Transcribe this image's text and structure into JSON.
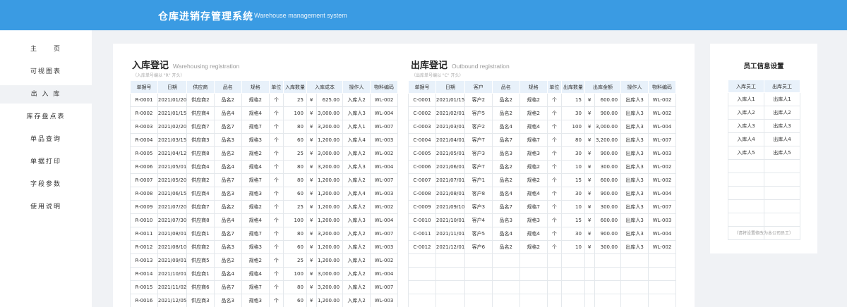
{
  "header": {
    "title": "仓库进销存管理系统",
    "subtitle": "Warehouse management system"
  },
  "sidebar": {
    "items": [
      {
        "label": "主　　页"
      },
      {
        "label": "可视图表"
      },
      {
        "label": "出 入 库"
      },
      {
        "label": "库存盘点表"
      },
      {
        "label": "单品查询"
      },
      {
        "label": "单据打印"
      },
      {
        "label": "字段参数"
      },
      {
        "label": "使用说明"
      }
    ]
  },
  "inbound": {
    "title": "入库登记",
    "title_en": "Warehousing registration",
    "note": "（入库单号编以 \"R\" 开头）",
    "columns": [
      "单据号",
      "日期",
      "供应商",
      "品名",
      "规格",
      "单位",
      "入库数量",
      "入库成本",
      "操作人",
      "物料编码"
    ],
    "rows": [
      [
        "R-0001",
        "2021/01/20",
        "供应商2",
        "品名2",
        "规格2",
        "个",
        "25",
        "¥",
        "625.00",
        "入库人2",
        "WL-002"
      ],
      [
        "R-0002",
        "2021/01/15",
        "供应商4",
        "品名4",
        "规格4",
        "个",
        "100",
        "¥",
        "3,000.00",
        "入库人3",
        "WL-004"
      ],
      [
        "R-0003",
        "2021/02/20",
        "供应商7",
        "品名7",
        "规格7",
        "个",
        "80",
        "¥",
        "3,200.00",
        "入库人1",
        "WL-007"
      ],
      [
        "R-0004",
        "2021/03/15",
        "供应商3",
        "品名3",
        "规格3",
        "个",
        "60",
        "¥",
        "1,200.00",
        "入库人4",
        "WL-003"
      ],
      [
        "R-0005",
        "2021/04/12",
        "供应商8",
        "品名2",
        "规格2",
        "个",
        "25",
        "¥",
        "3,000.00",
        "入库人2",
        "WL-002"
      ],
      [
        "R-0006",
        "2021/05/01",
        "供应商4",
        "品名4",
        "规格4",
        "个",
        "80",
        "¥",
        "3,200.00",
        "入库人3",
        "WL-004"
      ],
      [
        "R-0007",
        "2021/05/20",
        "供应商2",
        "品名7",
        "规格7",
        "个",
        "80",
        "¥",
        "1,200.00",
        "入库人2",
        "WL-007"
      ],
      [
        "R-0008",
        "2021/06/15",
        "供应商4",
        "品名3",
        "规格3",
        "个",
        "60",
        "¥",
        "1,200.00",
        "入库人4",
        "WL-003"
      ],
      [
        "R-0009",
        "2021/07/20",
        "供应商7",
        "品名2",
        "规格2",
        "个",
        "25",
        "¥",
        "1,200.00",
        "入库人2",
        "WL-002"
      ],
      [
        "R-0010",
        "2021/07/30",
        "供应商8",
        "品名4",
        "规格4",
        "个",
        "100",
        "¥",
        "1,200.00",
        "入库人3",
        "WL-004"
      ],
      [
        "R-0011",
        "2021/08/01",
        "供应商1",
        "品名7",
        "规格7",
        "个",
        "80",
        "¥",
        "3,200.00",
        "入库人2",
        "WL-007"
      ],
      [
        "R-0012",
        "2021/08/10",
        "供应商2",
        "品名3",
        "规格3",
        "个",
        "60",
        "¥",
        "1,200.00",
        "入库人2",
        "WL-003"
      ],
      [
        "R-0013",
        "2021/09/01",
        "供应商5",
        "品名2",
        "规格2",
        "个",
        "25",
        "¥",
        "1,200.00",
        "入库人2",
        "WL-002"
      ],
      [
        "R-0014",
        "2021/10/01",
        "供应商1",
        "品名4",
        "规格4",
        "个",
        "100",
        "¥",
        "3,000.00",
        "入库人2",
        "WL-004"
      ],
      [
        "R-0015",
        "2021/11/02",
        "供应商6",
        "品名7",
        "规格7",
        "个",
        "80",
        "¥",
        "3,200.00",
        "入库人2",
        "WL-007"
      ],
      [
        "R-0016",
        "2021/12/05",
        "供应商3",
        "品名3",
        "规格3",
        "个",
        "60",
        "¥",
        "1,200.00",
        "入库人2",
        "WL-003"
      ]
    ]
  },
  "outbound": {
    "title": "出库登记",
    "title_en": "Outbound registration",
    "note": "（出库单号编以 \"C\" 开头）",
    "columns": [
      "单据号",
      "日期",
      "客户",
      "品名",
      "规格",
      "单位",
      "出库数量",
      "出库金额",
      "操作人",
      "物料编码"
    ],
    "rows": [
      [
        "C-0001",
        "2021/01/15",
        "客户2",
        "品名2",
        "规格2",
        "个",
        "15",
        "¥",
        "600.00",
        "出库人3",
        "WL-002"
      ],
      [
        "C-0002",
        "2021/02/01",
        "客户5",
        "品名2",
        "规格2",
        "个",
        "30",
        "¥",
        "900.00",
        "出库人3",
        "WL-002"
      ],
      [
        "C-0003",
        "2021/03/01",
        "客户2",
        "品名4",
        "规格4",
        "个",
        "100",
        "¥",
        "3,000.00",
        "出库人3",
        "WL-004"
      ],
      [
        "C-0004",
        "2021/04/01",
        "客户7",
        "品名7",
        "规格7",
        "个",
        "80",
        "¥",
        "3,200.00",
        "出库人3",
        "WL-007"
      ],
      [
        "C-0005",
        "2021/05/01",
        "客户3",
        "品名3",
        "规格3",
        "个",
        "30",
        "¥",
        "900.00",
        "出库人3",
        "WL-003"
      ],
      [
        "C-0006",
        "2021/06/01",
        "客户7",
        "品名2",
        "规格2",
        "个",
        "10",
        "¥",
        "300.00",
        "出库人3",
        "WL-002"
      ],
      [
        "C-0007",
        "2021/07/01",
        "客户1",
        "品名2",
        "规格2",
        "个",
        "15",
        "¥",
        "600.00",
        "出库人3",
        "WL-002"
      ],
      [
        "C-0008",
        "2021/08/01",
        "客户8",
        "品名4",
        "规格4",
        "个",
        "30",
        "¥",
        "900.00",
        "出库人3",
        "WL-004"
      ],
      [
        "C-0009",
        "2021/09/10",
        "客户3",
        "品名7",
        "规格7",
        "个",
        "10",
        "¥",
        "300.00",
        "出库人3",
        "WL-007"
      ],
      [
        "C-0010",
        "2021/10/01",
        "客户4",
        "品名3",
        "规格3",
        "个",
        "15",
        "¥",
        "600.00",
        "出库人3",
        "WL-003"
      ],
      [
        "C-0011",
        "2021/11/01",
        "客户5",
        "品名4",
        "规格4",
        "个",
        "30",
        "¥",
        "900.00",
        "出库人3",
        "WL-004"
      ],
      [
        "C-0012",
        "2021/12/01",
        "客户6",
        "品名2",
        "规格2",
        "个",
        "10",
        "¥",
        "300.00",
        "出库人3",
        "WL-002"
      ]
    ]
  },
  "employees": {
    "title": "员工信息设置",
    "columns": [
      "入库员工",
      "出库员工"
    ],
    "rows": [
      [
        "入库人1",
        "出库人1"
      ],
      [
        "入库人2",
        "出库人2"
      ],
      [
        "入库人3",
        "出库人3"
      ],
      [
        "入库人4",
        "出库人4"
      ],
      [
        "入库人5",
        "出库人5"
      ]
    ],
    "note": "（请将设置修改为本公司员工）"
  }
}
